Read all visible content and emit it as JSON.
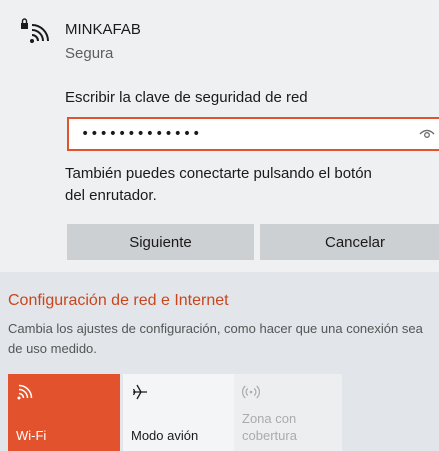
{
  "network": {
    "name": "MINKAFAB",
    "status": "Segura",
    "icon": "wifi-lock-icon"
  },
  "key_prompt": {
    "label": "Escribir la clave de seguridad de red",
    "value": "•••••••••••••",
    "reveal_icon": "eye-icon"
  },
  "router_hint": {
    "line1": "También puedes conectarte pulsando el botón",
    "line2": "del enrutador."
  },
  "buttons": {
    "next": "Siguiente",
    "cancel": "Cancelar"
  },
  "settings": {
    "link": "Configuración de red e Internet",
    "description": "Cambia los ajustes de configuración, como hacer que una conexión sea de uso medido."
  },
  "quick_actions": [
    {
      "label": "Wi-Fi",
      "icon": "wifi-icon",
      "active": true
    },
    {
      "label": "Modo avión",
      "icon": "airplane-icon",
      "active": false
    },
    {
      "label": "Zona con cobertura",
      "icon": "hotspot-icon",
      "active": false,
      "disabled": true
    }
  ],
  "colors": {
    "accent": "#e2532d",
    "link": "#c8461d",
    "button": "#cdd0d3"
  }
}
